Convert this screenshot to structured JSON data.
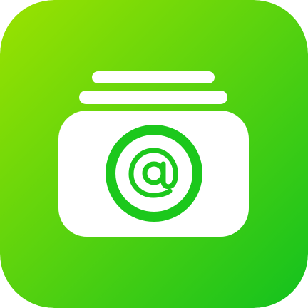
{
  "app_icon": {
    "name": "email-stack-app-icon",
    "background_gradient": {
      "start": "#9BE200",
      "end": "#12C21E"
    },
    "foreground_color": "#FFFFFF",
    "accent_color": "#1CC81C",
    "symbol": "@"
  }
}
